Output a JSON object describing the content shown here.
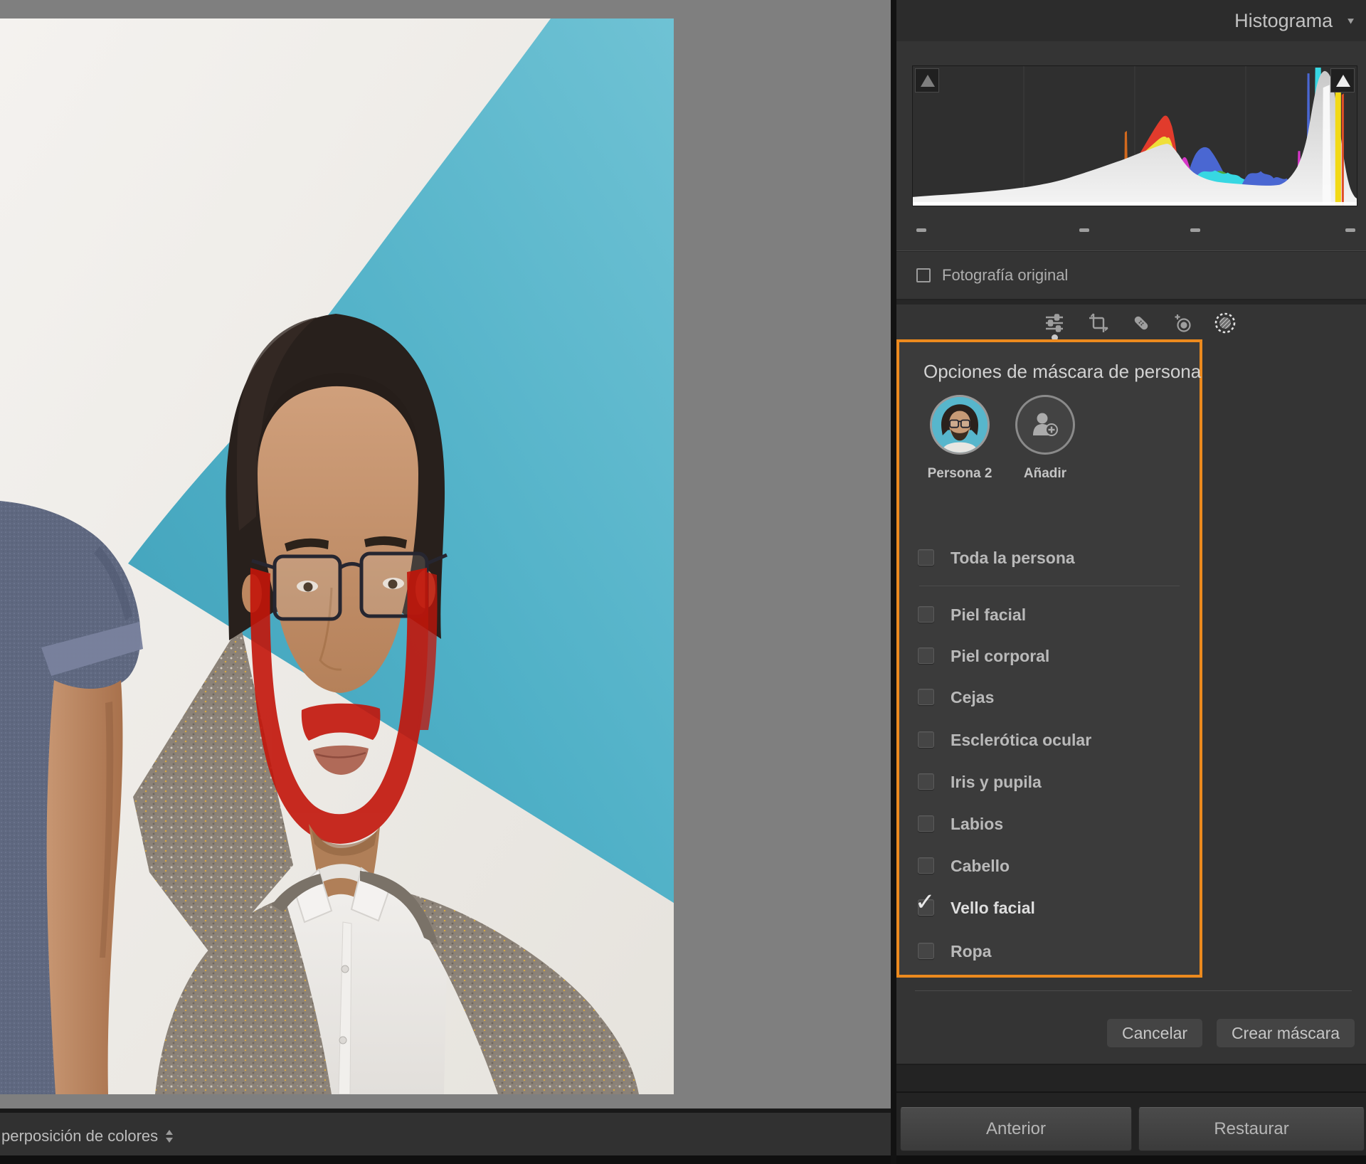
{
  "histogram_panel": {
    "title": "Histograma",
    "collapse_icon": "▼",
    "original_photo_label": "Fotografía original"
  },
  "histogram": {
    "type": "rgb-histogram",
    "channel_colors": {
      "luminance": "#d6d6d6",
      "red": "#e13b2c",
      "yellow": "#efdf39",
      "green": "#4da839",
      "cyan": "#37d7e2",
      "blue": "#4a67d2",
      "magenta": "#d636c8"
    },
    "shadow_clipping_indicator": "triangle",
    "highlight_clipping_indicator": "triangle"
  },
  "tool_strip": {
    "icons": [
      {
        "name": "basic-adjustments",
        "active": true
      },
      {
        "name": "crop",
        "active": false
      },
      {
        "name": "healing",
        "active": false
      },
      {
        "name": "red-eye",
        "active": false
      },
      {
        "name": "masking",
        "active": true
      }
    ]
  },
  "mask_options": {
    "title": "Opciones de máscara de persona",
    "people": [
      {
        "label": "Persona 2"
      },
      {
        "label": "Añadir"
      }
    ],
    "options": [
      {
        "label": "Toda la persona",
        "checked": false
      },
      {
        "label": "Piel facial",
        "checked": false
      },
      {
        "label": "Piel corporal",
        "checked": false
      },
      {
        "label": "Cejas",
        "checked": false
      },
      {
        "label": "Esclerótica ocular",
        "checked": false
      },
      {
        "label": "Iris y pupila",
        "checked": false
      },
      {
        "label": "Labios",
        "checked": false
      },
      {
        "label": "Cabello",
        "checked": false
      },
      {
        "label": "Vello facial",
        "checked": true
      },
      {
        "label": "Ropa",
        "checked": false
      }
    ],
    "check_glyph": "✓",
    "cancel_label": "Cancelar",
    "create_label": "Crear máscara"
  },
  "footer": {
    "previous_label": "Anterior",
    "reset_label": "Restaurar"
  },
  "bottom_toolbar": {
    "label": "perposición de colores",
    "selector_icon": "up-down-arrows"
  },
  "colors": {
    "accent_orange": "#ec8a1e",
    "backdrop_teal": "#57b6cc",
    "panel_bg": "#343434",
    "canvas_grey": "#7f7f7f"
  }
}
